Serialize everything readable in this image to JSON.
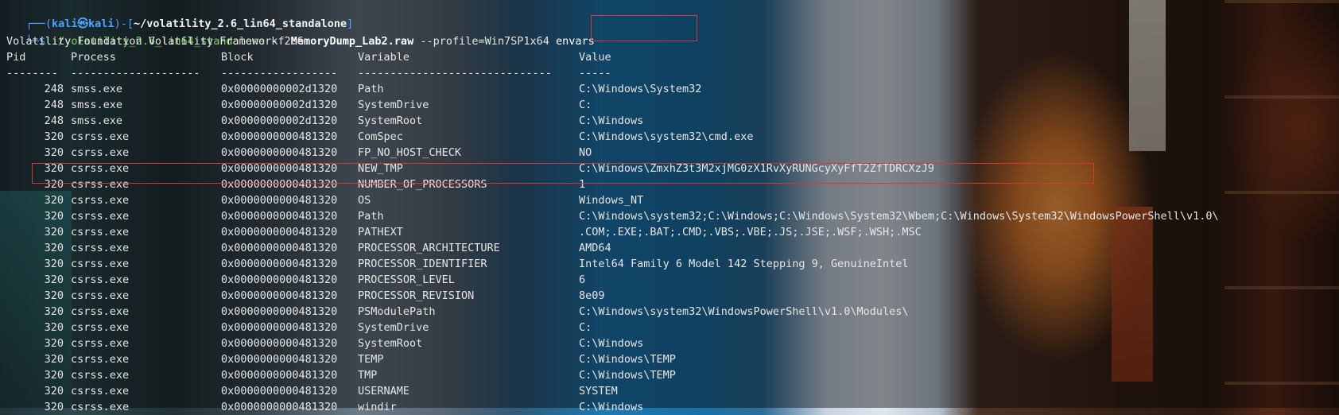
{
  "prompt": {
    "frame_top": "┌──(",
    "user": "kali",
    "at": "㉿",
    "host": "kali",
    "frame_mid": ")-[",
    "path": "~/volatility_2.6_lin64_standalone",
    "frame_end": "]",
    "frame_bottom": "└─$ ",
    "command": "./volatility_2.6_lin64_standalone",
    "flag_f": " -f ",
    "file": "MemoryDump_Lab2.raw",
    "profile": " --profile=Win7SP1x64 ",
    "plugin": "envars"
  },
  "banner": "Volatility Foundation Volatility Framework 2.6",
  "table": {
    "headers": {
      "pid": "Pid",
      "process": "Process",
      "block": "Block",
      "variable": "Variable",
      "value": "Value"
    },
    "separators": {
      "pid": "--------",
      "process": "--------------------",
      "block": "------------------",
      "variable": "------------------------------",
      "value": "-----"
    },
    "rows": [
      {
        "pid": "248",
        "process": "smss.exe",
        "block": "0x00000000002d1320",
        "variable": "Path",
        "value": "C:\\Windows\\System32"
      },
      {
        "pid": "248",
        "process": "smss.exe",
        "block": "0x00000000002d1320",
        "variable": "SystemDrive",
        "value": "C:"
      },
      {
        "pid": "248",
        "process": "smss.exe",
        "block": "0x00000000002d1320",
        "variable": "SystemRoot",
        "value": "C:\\Windows"
      },
      {
        "pid": "320",
        "process": "csrss.exe",
        "block": "0x0000000000481320",
        "variable": "ComSpec",
        "value": "C:\\Windows\\system32\\cmd.exe"
      },
      {
        "pid": "320",
        "process": "csrss.exe",
        "block": "0x0000000000481320",
        "variable": "FP_NO_HOST_CHECK",
        "value": "NO"
      },
      {
        "pid": "320",
        "process": "csrss.exe",
        "block": "0x0000000000481320",
        "variable": "NEW_TMP",
        "value": "C:\\Windows\\ZmxhZ3t3M2xjMG0zX1RvXyRUNGcyXyFfT2ZfTDRCXzJ9"
      },
      {
        "pid": "320",
        "process": "csrss.exe",
        "block": "0x0000000000481320",
        "variable": "NUMBER_OF_PROCESSORS",
        "value": "1"
      },
      {
        "pid": "320",
        "process": "csrss.exe",
        "block": "0x0000000000481320",
        "variable": "OS",
        "value": "Windows_NT"
      },
      {
        "pid": "320",
        "process": "csrss.exe",
        "block": "0x0000000000481320",
        "variable": "Path",
        "value": "C:\\Windows\\system32;C:\\Windows;C:\\Windows\\System32\\Wbem;C:\\Windows\\System32\\WindowsPowerShell\\v1.0\\"
      },
      {
        "pid": "320",
        "process": "csrss.exe",
        "block": "0x0000000000481320",
        "variable": "PATHEXT",
        "value": ".COM;.EXE;.BAT;.CMD;.VBS;.VBE;.JS;.JSE;.WSF;.WSH;.MSC"
      },
      {
        "pid": "320",
        "process": "csrss.exe",
        "block": "0x0000000000481320",
        "variable": "PROCESSOR_ARCHITECTURE",
        "value": "AMD64"
      },
      {
        "pid": "320",
        "process": "csrss.exe",
        "block": "0x0000000000481320",
        "variable": "PROCESSOR_IDENTIFIER",
        "value": "Intel64 Family 6 Model 142 Stepping 9, GenuineIntel"
      },
      {
        "pid": "320",
        "process": "csrss.exe",
        "block": "0x0000000000481320",
        "variable": "PROCESSOR_LEVEL",
        "value": "6"
      },
      {
        "pid": "320",
        "process": "csrss.exe",
        "block": "0x0000000000481320",
        "variable": "PROCESSOR_REVISION",
        "value": "8e09"
      },
      {
        "pid": "320",
        "process": "csrss.exe",
        "block": "0x0000000000481320",
        "variable": "PSModulePath",
        "value": "C:\\Windows\\system32\\WindowsPowerShell\\v1.0\\Modules\\"
      },
      {
        "pid": "320",
        "process": "csrss.exe",
        "block": "0x0000000000481320",
        "variable": "SystemDrive",
        "value": "C:"
      },
      {
        "pid": "320",
        "process": "csrss.exe",
        "block": "0x0000000000481320",
        "variable": "SystemRoot",
        "value": "C:\\Windows"
      },
      {
        "pid": "320",
        "process": "csrss.exe",
        "block": "0x0000000000481320",
        "variable": "TEMP",
        "value": "C:\\Windows\\TEMP"
      },
      {
        "pid": "320",
        "process": "csrss.exe",
        "block": "0x0000000000481320",
        "variable": "TMP",
        "value": "C:\\Windows\\TEMP"
      },
      {
        "pid": "320",
        "process": "csrss.exe",
        "block": "0x0000000000481320",
        "variable": "USERNAME",
        "value": "SYSTEM"
      },
      {
        "pid": "320",
        "process": "csrss.exe",
        "block": "0x0000000000481320",
        "variable": "windir",
        "value": "C:\\Windows"
      }
    ]
  },
  "colors": {
    "highlight_box": "#d23a3a",
    "prompt_blue": "#4ea3ff",
    "command_green": "#7ed36a"
  }
}
